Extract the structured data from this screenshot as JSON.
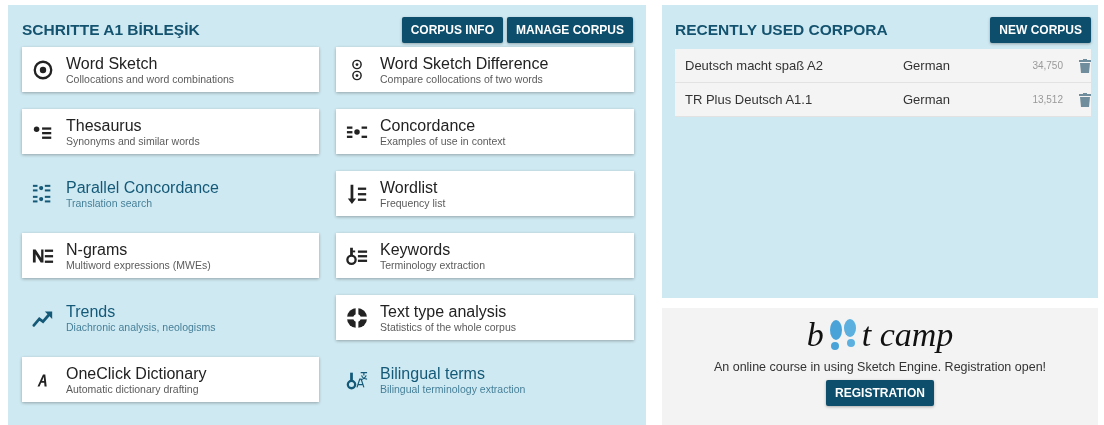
{
  "corpus_panel": {
    "title": "SCHRITTE A1 BİRLEŞİK",
    "buttons": [
      "CORPUS INFO",
      "MANAGE CORPUS"
    ],
    "tools": [
      {
        "name": "Word Sketch",
        "description": "Collocations and word combinations",
        "kind": "card"
      },
      {
        "name": "Word Sketch Difference",
        "description": "Compare collocations of two words",
        "kind": "card"
      },
      {
        "name": "Thesaurus",
        "description": "Synonyms and similar words",
        "kind": "card"
      },
      {
        "name": "Concordance",
        "description": "Examples of use in context",
        "kind": "card"
      },
      {
        "name": "Parallel Concordance",
        "description": "Translation search",
        "kind": "plain"
      },
      {
        "name": "Wordlist",
        "description": "Frequency list",
        "kind": "card"
      },
      {
        "name": "N-grams",
        "description": "Multiword expressions (MWEs)",
        "kind": "card"
      },
      {
        "name": "Keywords",
        "description": "Terminology extraction",
        "kind": "card"
      },
      {
        "name": "Trends",
        "description": "Diachronic analysis, neologisms",
        "kind": "plain"
      },
      {
        "name": "Text type analysis",
        "description": "Statistics of the whole corpus",
        "kind": "card"
      },
      {
        "name": "OneClick Dictionary",
        "description": "Automatic dictionary drafting",
        "kind": "card"
      },
      {
        "name": "Bilingual terms",
        "description": "Bilingual terminology extraction",
        "kind": "plain"
      }
    ]
  },
  "recent_panel": {
    "title": "RECENTLY USED CORPORA",
    "button": "NEW CORPUS",
    "rows": [
      {
        "name": "Deutsch macht spaß A2",
        "language": "German",
        "size": "34,750"
      },
      {
        "name": "TR Plus Deutsch A1.1",
        "language": "German",
        "size": "13,512"
      }
    ]
  },
  "bootcamp": {
    "logo_parts": [
      "b",
      "t camp"
    ],
    "text": "An online course in using Sketch Engine. Registration open!",
    "button": "REGISTRATION"
  }
}
